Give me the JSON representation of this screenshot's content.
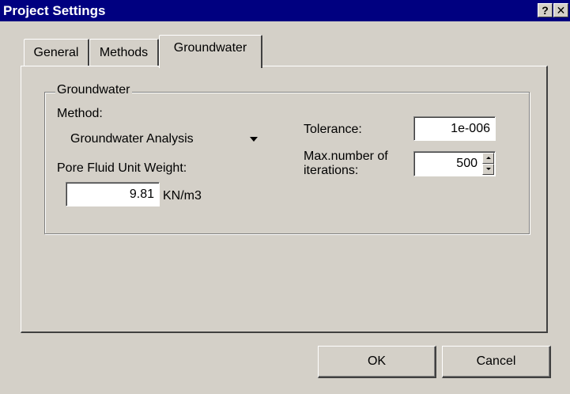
{
  "window": {
    "title": "Project Settings",
    "help_label": "?",
    "close_label": "✕"
  },
  "tabs": [
    {
      "label": "General",
      "active": false
    },
    {
      "label": "Methods",
      "active": false
    },
    {
      "label": "Groundwater",
      "active": true
    }
  ],
  "group": {
    "title": "Groundwater",
    "method_label": "Method:",
    "method_value": "Groundwater Analysis",
    "pore_label": "Pore Fluid Unit Weight:",
    "pore_value": "9.81",
    "pore_unit": "KN/m3",
    "tolerance_label": "Tolerance:",
    "tolerance_value": "1e-006",
    "max_iter_label_line1": "Max.number of",
    "max_iter_label_line2": "iterations:",
    "max_iter_value": "500"
  },
  "buttons": {
    "ok": "OK",
    "cancel": "Cancel"
  }
}
